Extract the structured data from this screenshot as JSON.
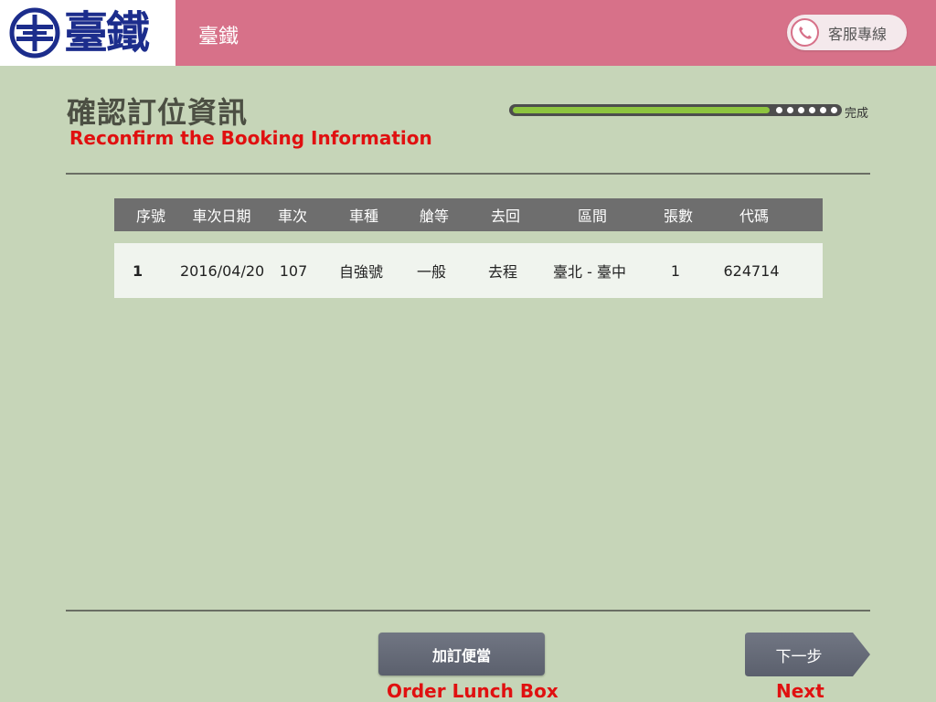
{
  "header": {
    "logo_text": "臺鐵",
    "title": "臺鐵",
    "hotline_label": "客服專線",
    "brand_color": "#d77189",
    "logo_color": "#1c2d8c"
  },
  "page": {
    "title": "確認訂位資訊",
    "subtitle": "Reconfirm the Booking Information"
  },
  "progress": {
    "value": 0.79,
    "label": "完成"
  },
  "table": {
    "headers": [
      "序號",
      "車次日期",
      "車次",
      "車種",
      "艙等",
      "去回",
      "區間",
      "張數",
      "代碼"
    ],
    "rows": [
      [
        "1",
        "2016/04/20",
        "107",
        "自強號",
        "一般",
        "去程",
        "臺北 - 臺中",
        "1",
        "624714"
      ]
    ]
  },
  "actions": {
    "lunch_label": "加訂便當",
    "lunch_caption": "Order Lunch Box",
    "next_label": "下一步",
    "next_caption": "Next"
  },
  "icons": {
    "logo": "taiwan-railway-logo-icon",
    "hotline": "phone-icon"
  }
}
